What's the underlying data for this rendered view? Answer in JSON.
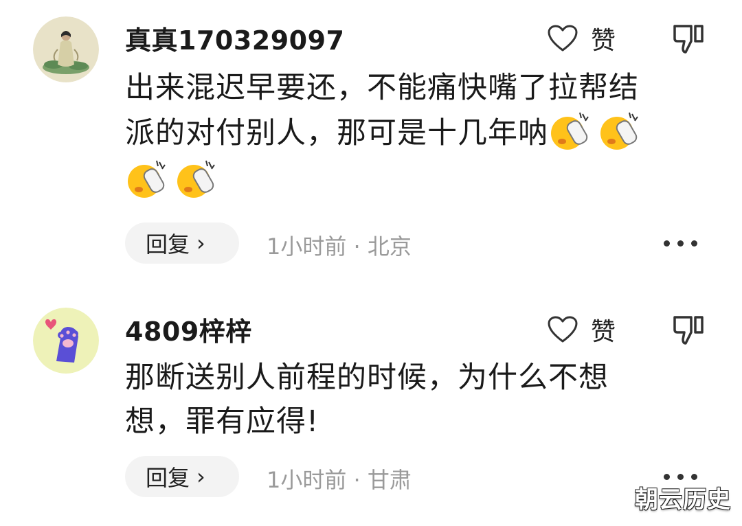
{
  "comments": [
    {
      "username": "真真170329097",
      "like_label": "赞",
      "text_line1": "出来混迟早要还，不能痛快嘴了拉帮结",
      "text_line2": "派的对付别人，那可是十几年呐",
      "emoji": "slipper-slap-emoji",
      "reply_label": "回复",
      "meta": "1小时前 · 北京"
    },
    {
      "username": "4809梓梓",
      "like_label": "赞",
      "text_line1": "那断送别人前程的时候，为什么不想",
      "text_line2": "想，罪有应得!",
      "reply_label": "回复",
      "meta": "1小时前 · 甘肃"
    }
  ],
  "watermark": "朝云历史",
  "colors": {
    "meta_gray": "#9a9a9a",
    "reply_bg": "#f3f3f3",
    "avatar2_paw": "#5a4fd6"
  }
}
